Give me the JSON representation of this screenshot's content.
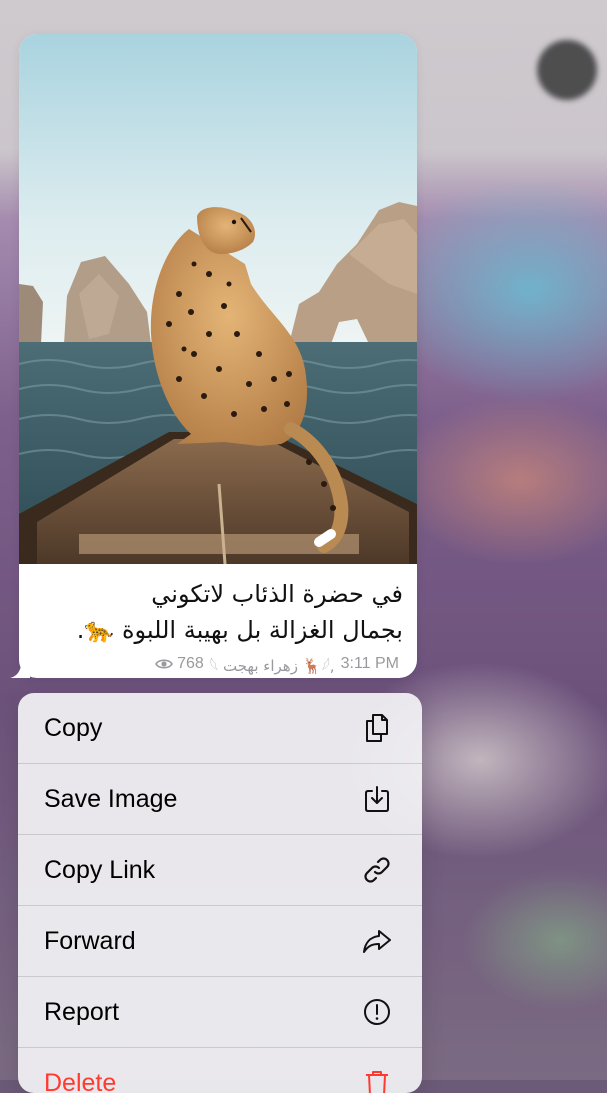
{
  "message": {
    "caption_line1": "في حضرة الذئاب لاتكوني",
    "caption_line2": "بجمال الغزالة بل بهيبة اللبوة 🐆.",
    "views": "768",
    "author": "𓆩 زهراء بهجت 🦌𓆪,",
    "time": "3:11 PM"
  },
  "menu": {
    "items": [
      {
        "label": "Copy",
        "icon": "copy-icon"
      },
      {
        "label": "Save Image",
        "icon": "save-image-icon"
      },
      {
        "label": "Copy Link",
        "icon": "link-icon"
      },
      {
        "label": "Forward",
        "icon": "forward-icon"
      },
      {
        "label": "Report",
        "icon": "report-icon"
      },
      {
        "label": "Delete",
        "icon": "trash-icon"
      }
    ]
  },
  "colors": {
    "danger": "#ff3b30",
    "meta_text": "#9a9a9e",
    "menu_bg": "#f2f2f4"
  }
}
